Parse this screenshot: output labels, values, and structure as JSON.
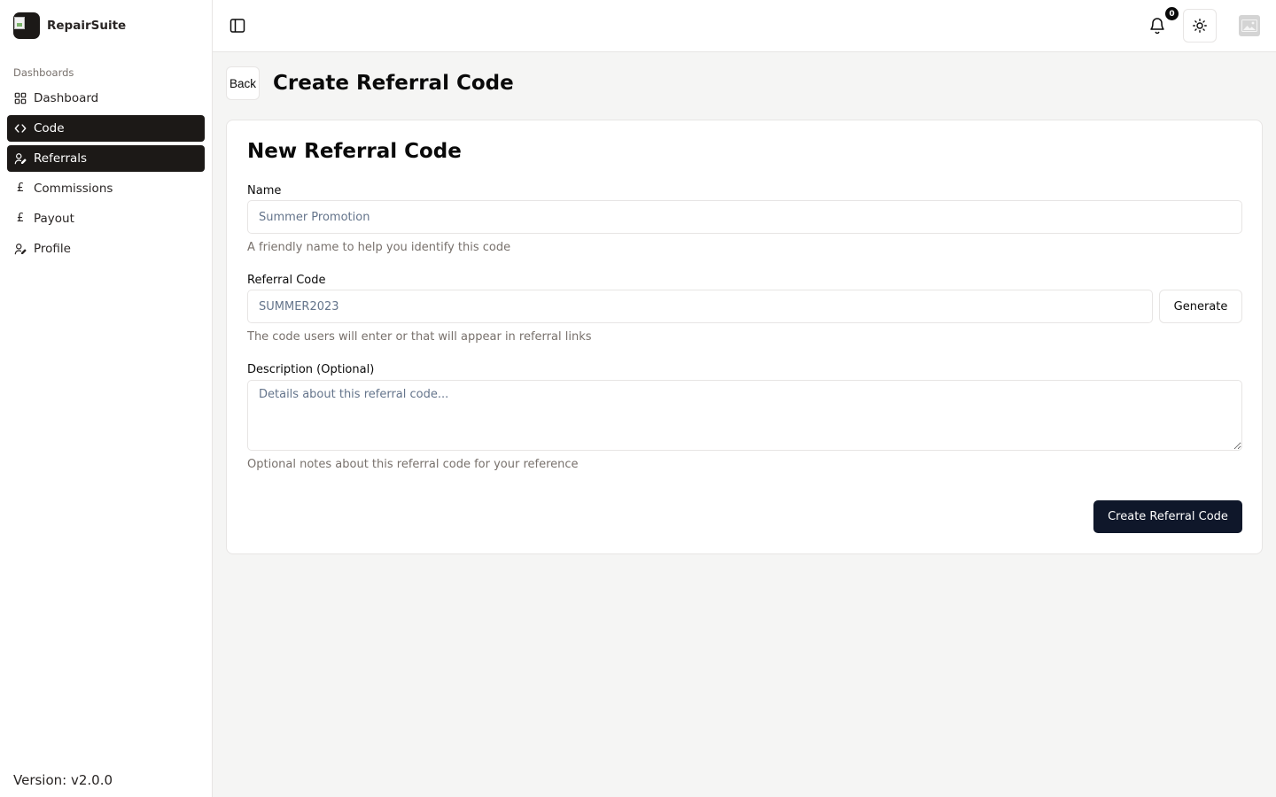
{
  "brand": {
    "name": "RepairSuite"
  },
  "sidebar": {
    "section_label": "Dashboards",
    "items": [
      {
        "label": "Dashboard",
        "icon": "grid-icon",
        "active": false
      },
      {
        "label": "Code",
        "icon": "code-icon",
        "active": true
      },
      {
        "label": "Referrals",
        "icon": "user-pen-icon",
        "active": true
      },
      {
        "label": "Commissions",
        "icon": "pound-icon",
        "active": false
      },
      {
        "label": "Payout",
        "icon": "pound-icon",
        "active": false
      },
      {
        "label": "Profile",
        "icon": "user-pen-icon",
        "active": false
      }
    ],
    "version": "Version: v2.0.0"
  },
  "topbar": {
    "notification_count": "0"
  },
  "page": {
    "back_label": "Back",
    "title": "Create Referral Code"
  },
  "form": {
    "card_title": "New Referral Code",
    "name": {
      "label": "Name",
      "placeholder": "Summer Promotion",
      "help": "A friendly name to help you identify this code"
    },
    "code": {
      "label": "Referral Code",
      "placeholder": "SUMMER2023",
      "help": "The code users will enter or that will appear in referral links",
      "generate_label": "Generate"
    },
    "description": {
      "label": "Description (Optional)",
      "placeholder": "Details about this referral code...",
      "help": "Optional notes about this referral code for your reference"
    },
    "submit_label": "Create Referral Code"
  },
  "colors": {
    "sidebar_active_bg": "#1c1917",
    "primary_button": "#0f172a",
    "page_bg": "#f5f5f4",
    "border": "#e7e5e4"
  }
}
